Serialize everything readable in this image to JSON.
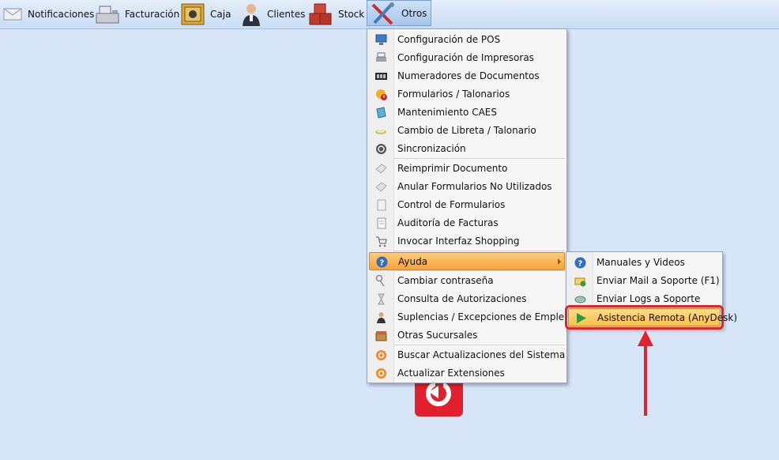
{
  "toolbar": {
    "items": [
      {
        "label": "Notificaciones",
        "icon": "envelope-icon"
      },
      {
        "label": "Facturación",
        "icon": "cash-register-icon"
      },
      {
        "label": "Caja",
        "icon": "safe-icon"
      },
      {
        "label": "Clientes",
        "icon": "person-icon"
      },
      {
        "label": "Stock",
        "icon": "boxes-icon"
      },
      {
        "label": "Otros",
        "icon": "tools-icon"
      }
    ]
  },
  "menu": {
    "items": [
      {
        "label": "Configuración de POS",
        "icon": "monitor-icon"
      },
      {
        "label": "Configuración de Impresoras",
        "icon": "printer-icon"
      },
      {
        "label": "Numeradores de Documentos",
        "icon": "counter-icon"
      },
      {
        "label": "Formularios / Talonarios",
        "icon": "forms-warning-icon"
      },
      {
        "label": "Mantenimiento CAES",
        "icon": "book-icon"
      },
      {
        "label": "Cambio de Libreta / Talonario",
        "icon": "booklet-icon"
      },
      {
        "label": "Sincronización",
        "icon": "sync-icon"
      },
      {
        "label": "Reimprimir Documento",
        "icon": "reprint-icon"
      },
      {
        "label": "Anular Formularios No Utilizados",
        "icon": "void-forms-icon"
      },
      {
        "label": "Control de Formularios",
        "icon": "document-icon"
      },
      {
        "label": "Auditoría de Facturas",
        "icon": "invoice-icon"
      },
      {
        "label": "Invocar Interfaz Shopping",
        "icon": "cart-icon"
      },
      {
        "label": "Ayuda",
        "icon": "help-icon"
      },
      {
        "label": "Cambiar contraseña",
        "icon": "key-icon"
      },
      {
        "label": "Consulta de Autorizaciones",
        "icon": "hourglass-icon"
      },
      {
        "label": "Suplencias / Excepciones de Empleados",
        "icon": "employee-icon"
      },
      {
        "label": "Otras Sucursales",
        "icon": "stores-icon"
      },
      {
        "label": "Buscar Actualizaciones del Sistema",
        "icon": "update-icon"
      },
      {
        "label": "Actualizar Extensiones",
        "icon": "update-icon"
      }
    ]
  },
  "submenu": {
    "items": [
      {
        "label": "Manuales y Videos",
        "icon": "help-icon"
      },
      {
        "label": "Enviar Mail a Soporte (F1)",
        "icon": "mail-icon"
      },
      {
        "label": "Enviar Logs a Soporte",
        "icon": "logs-icon"
      },
      {
        "label": "Asistencia Remota (AnyDesk)",
        "icon": "play-icon"
      }
    ]
  },
  "colors": {
    "background": "#d6e5f8",
    "highlight": "#f7a23a",
    "annotation": "#e3202b"
  }
}
